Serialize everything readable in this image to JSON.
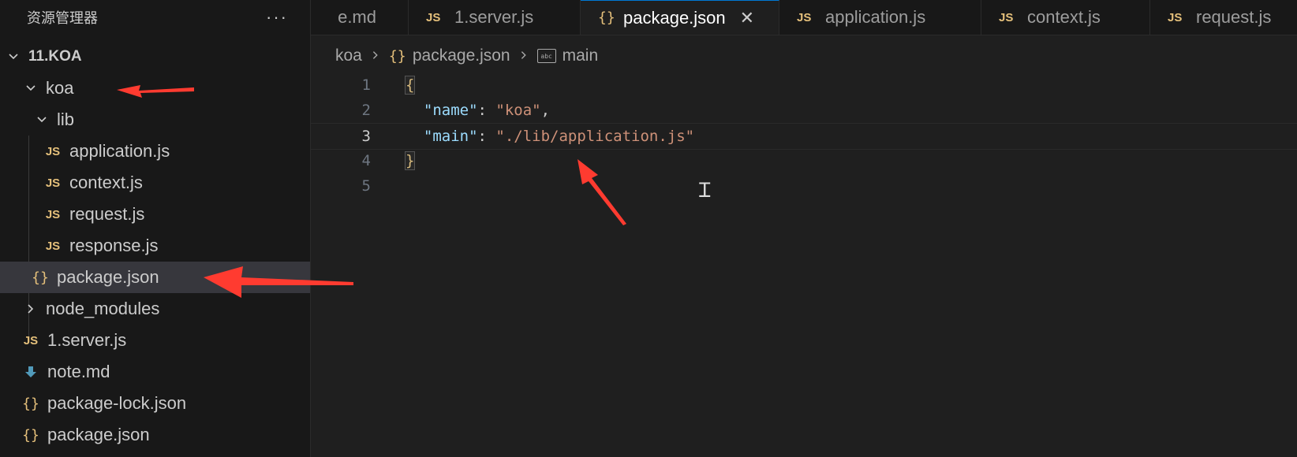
{
  "sidebar": {
    "title": "资源管理器",
    "more": "···",
    "tree": [
      {
        "label": "11.KOA",
        "chev": "down",
        "icon": "none"
      },
      {
        "label": "koa",
        "chev": "down",
        "icon": "none"
      },
      {
        "label": "lib",
        "chev": "down",
        "icon": "none"
      },
      {
        "label": "application.js",
        "icon": "JS"
      },
      {
        "label": "context.js",
        "icon": "JS"
      },
      {
        "label": "request.js",
        "icon": "JS"
      },
      {
        "label": "response.js",
        "icon": "JS"
      },
      {
        "label": "package.json",
        "icon": "{}",
        "selected": true
      },
      {
        "label": "node_modules",
        "chev": "right",
        "icon": "none"
      },
      {
        "label": "1.server.js",
        "icon": "JS"
      },
      {
        "label": "note.md",
        "icon": "md"
      },
      {
        "label": "package-lock.json",
        "icon": "{}"
      },
      {
        "label": "package.json",
        "icon": "{}"
      }
    ]
  },
  "tabs": [
    {
      "label": "e.md",
      "icon": "none"
    },
    {
      "label": "1.server.js",
      "icon": "JS"
    },
    {
      "label": "package.json",
      "icon": "{}",
      "active": true,
      "close": "✕"
    },
    {
      "label": "application.js",
      "icon": "JS"
    },
    {
      "label": "context.js",
      "icon": "JS"
    },
    {
      "label": "request.js",
      "icon": "JS"
    }
  ],
  "breadcrumb": {
    "folder": "koa",
    "file_icon": "{}",
    "file": "package.json",
    "symbol_icon": "abc",
    "symbol": "main"
  },
  "editor": {
    "lines": [
      {
        "num": "1",
        "text": "{"
      },
      {
        "num": "2",
        "key": "\"name\"",
        "sep": ": ",
        "value": "\"koa\"",
        "end": ","
      },
      {
        "num": "3",
        "key": "\"main\"",
        "sep": ": ",
        "value": "\"./lib/application.js\"",
        "end": ""
      },
      {
        "num": "4",
        "text": "}"
      },
      {
        "num": "5",
        "text": ""
      }
    ]
  },
  "colors": {
    "annotation_arrow": "#ff3b30",
    "js_icon": "#e5c07b",
    "json_key": "#9cdcfe",
    "json_string": "#ce9178"
  }
}
